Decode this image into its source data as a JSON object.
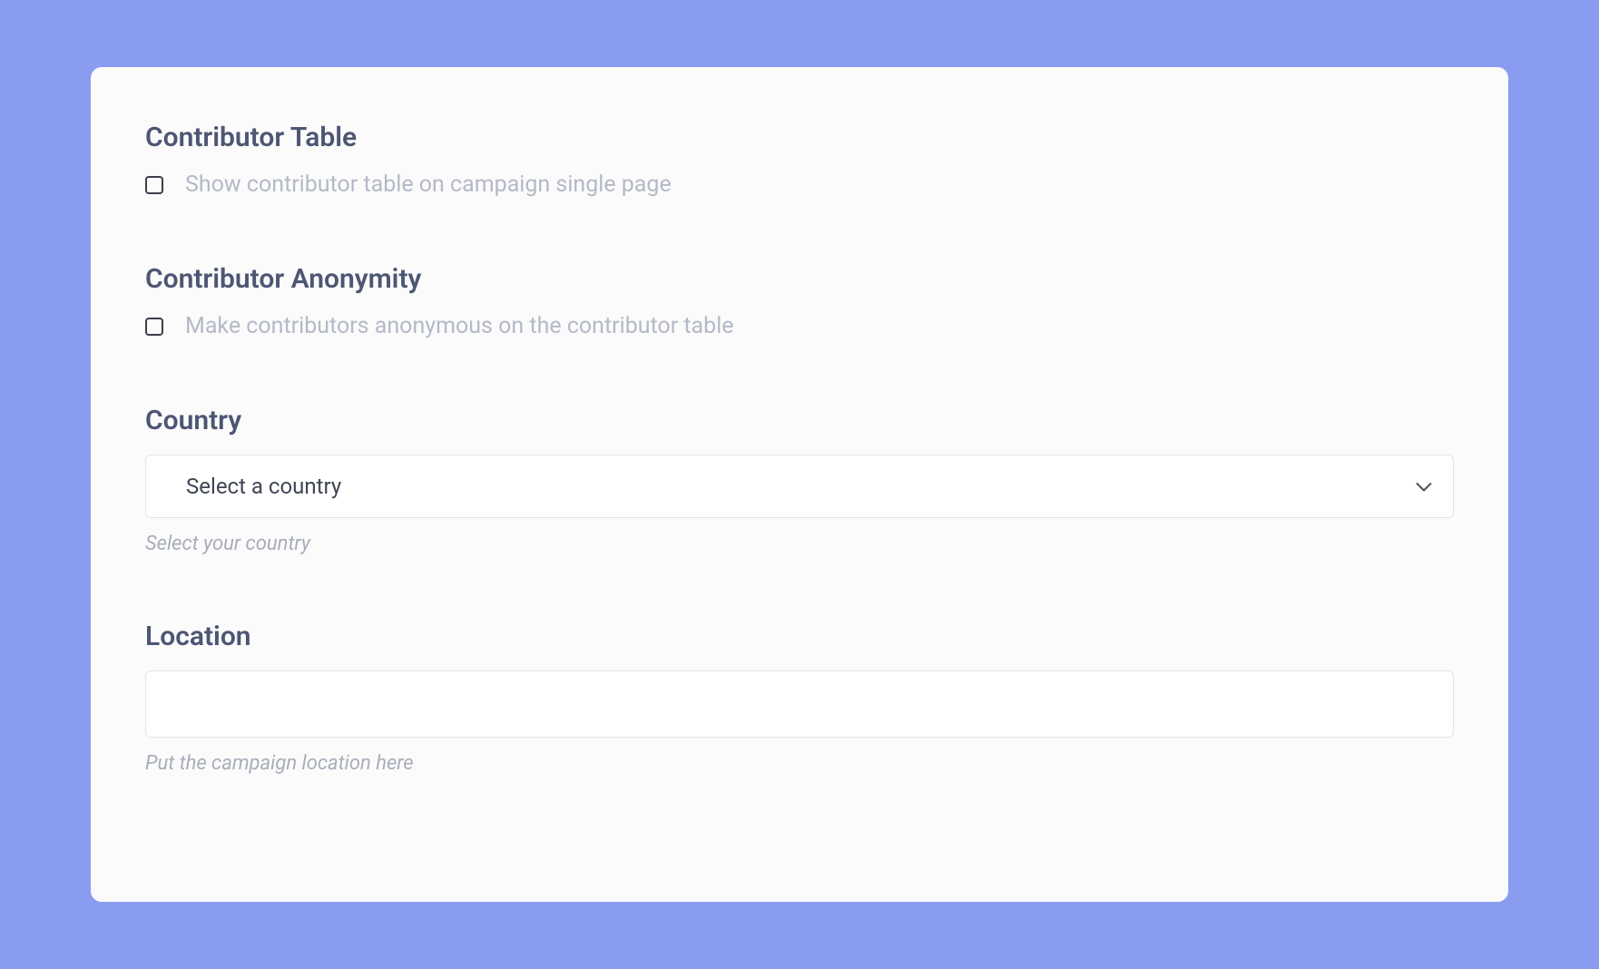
{
  "sections": {
    "contributorTable": {
      "title": "Contributor Table",
      "checkboxLabel": "Show contributor table on campaign single page"
    },
    "contributorAnonymity": {
      "title": "Contributor Anonymity",
      "checkboxLabel": "Make contributors anonymous on the contributor table"
    },
    "country": {
      "title": "Country",
      "placeholder": "Select a country",
      "helper": "Select your country"
    },
    "location": {
      "title": "Location",
      "value": "",
      "helper": "Put the campaign location here"
    }
  }
}
